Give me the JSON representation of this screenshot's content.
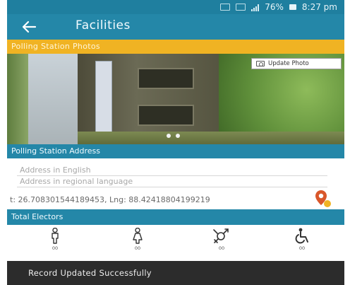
{
  "status_bar": {
    "battery": "76%",
    "time": "8:27 pm"
  },
  "toolbar": {
    "title": "Facilities"
  },
  "photos": {
    "header": "Polling Station Photos",
    "update_label": "Update Photo",
    "page_count": 2,
    "active_page": 1
  },
  "address": {
    "header": "Polling Station Address",
    "english_placeholder": "Address in English",
    "regional_placeholder": "Address in regional language",
    "latlng": "t: 26.708301544189453, Lng: 88.4241880419921​9"
  },
  "electors": {
    "header": "Total Electors",
    "items": [
      {
        "icon": "male-icon",
        "count": "00"
      },
      {
        "icon": "female-icon",
        "count": "00"
      },
      {
        "icon": "third-gender-icon",
        "count": "00"
      },
      {
        "icon": "wheelchair-icon",
        "count": "00"
      }
    ]
  },
  "toast": {
    "message": "Record Updated Successfully"
  },
  "colors": {
    "primary": "#2487a8",
    "accent": "#f0b323",
    "toast_bg": "#2c2c2c",
    "pin": "#d9572b"
  }
}
